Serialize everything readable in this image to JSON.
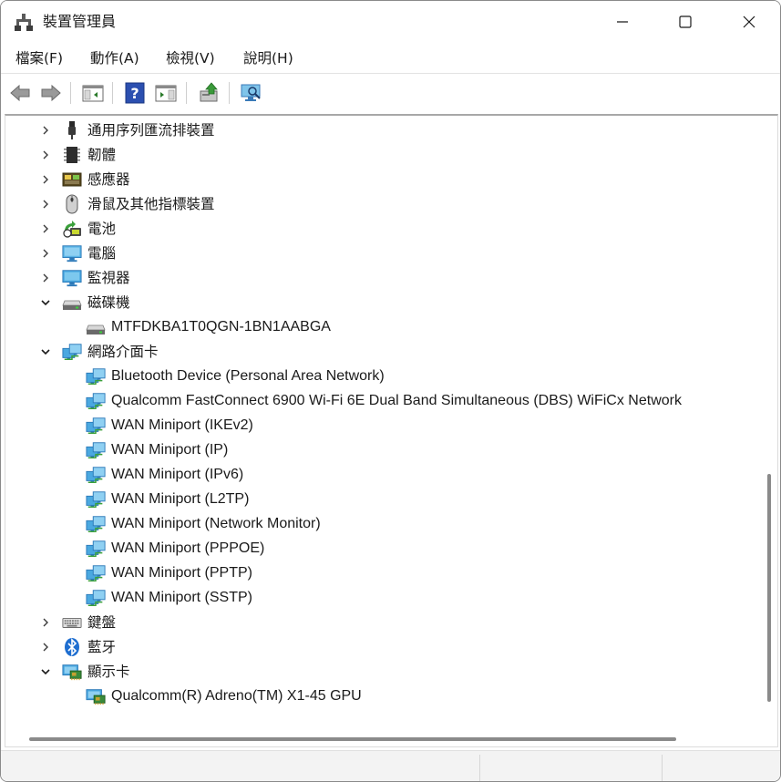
{
  "window": {
    "title": "裝置管理員"
  },
  "menu": [
    {
      "label": "檔案(F)"
    },
    {
      "label": "動作(A)"
    },
    {
      "label": "檢視(V)"
    },
    {
      "label": "說明(H)"
    }
  ],
  "toolbar": {
    "buttons": [
      {
        "icon": "back-arrow-icon"
      },
      {
        "icon": "forward-arrow-icon"
      },
      {
        "icon": "show-hide-console-tree-icon"
      },
      {
        "icon": "help-icon"
      },
      {
        "icon": "action-pane-icon"
      },
      {
        "icon": "update-driver-icon"
      },
      {
        "icon": "scan-hardware-changes-icon"
      }
    ]
  },
  "tree": [
    {
      "label": "通用序列匯流排裝置",
      "expanded": false,
      "icon": "usb-icon"
    },
    {
      "label": "韌體",
      "expanded": false,
      "icon": "chip-icon"
    },
    {
      "label": "感應器",
      "expanded": false,
      "icon": "sensor-icon"
    },
    {
      "label": "滑鼠及其他指標裝置",
      "expanded": false,
      "icon": "mouse-icon"
    },
    {
      "label": "電池",
      "expanded": false,
      "icon": "battery-icon"
    },
    {
      "label": "電腦",
      "expanded": false,
      "icon": "computer-icon"
    },
    {
      "label": "監視器",
      "expanded": false,
      "icon": "monitor-icon"
    },
    {
      "label": "磁碟機",
      "expanded": true,
      "icon": "drive-icon",
      "children": [
        {
          "label": "MTFDKBA1T0QGN-1BN1AABGA",
          "icon": "drive-icon"
        }
      ]
    },
    {
      "label": "網路介面卡",
      "expanded": true,
      "icon": "network-adapter-icon",
      "children": [
        {
          "label": "Bluetooth Device (Personal Area Network)",
          "icon": "network-adapter-icon"
        },
        {
          "label": "Qualcomm FastConnect 6900 Wi-Fi 6E Dual Band Simultaneous (DBS) WiFiCx Network",
          "icon": "network-adapter-icon"
        },
        {
          "label": "WAN Miniport (IKEv2)",
          "icon": "network-adapter-icon"
        },
        {
          "label": "WAN Miniport (IP)",
          "icon": "network-adapter-icon"
        },
        {
          "label": "WAN Miniport (IPv6)",
          "icon": "network-adapter-icon"
        },
        {
          "label": "WAN Miniport (L2TP)",
          "icon": "network-adapter-icon"
        },
        {
          "label": "WAN Miniport (Network Monitor)",
          "icon": "network-adapter-icon"
        },
        {
          "label": "WAN Miniport (PPPOE)",
          "icon": "network-adapter-icon"
        },
        {
          "label": "WAN Miniport (PPTP)",
          "icon": "network-adapter-icon"
        },
        {
          "label": "WAN Miniport (SSTP)",
          "icon": "network-adapter-icon"
        }
      ]
    },
    {
      "label": "鍵盤",
      "expanded": false,
      "icon": "keyboard-icon"
    },
    {
      "label": "藍牙",
      "expanded": false,
      "icon": "bluetooth-icon"
    },
    {
      "label": "顯示卡",
      "expanded": true,
      "icon": "display-adapter-icon",
      "children": [
        {
          "label": "Qualcomm(R) Adreno(TM) X1-45 GPU",
          "icon": "display-adapter-icon"
        }
      ]
    }
  ]
}
